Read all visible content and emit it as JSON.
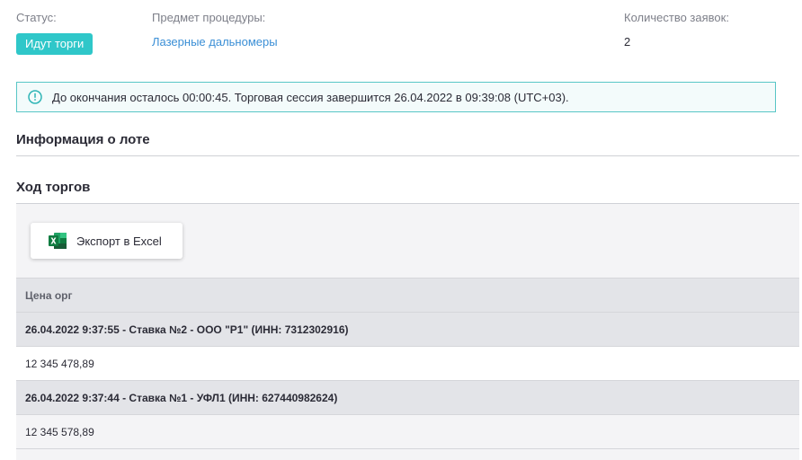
{
  "status": {
    "label": "Статус:",
    "badge": "Идут торги"
  },
  "subject": {
    "label": "Предмет процедуры:",
    "value": "Лазерные дальномеры"
  },
  "applications": {
    "label": "Количество заявок:",
    "value": "2"
  },
  "alert": {
    "text": "До окончания осталось 00:00:45. Торговая сессия завершится 26.04.2022 в 09:39:08 (UTC+03).",
    "icon": "info-icon"
  },
  "sections": {
    "lot_info": "Информация о лоте",
    "bidding": "Ход торгов"
  },
  "export": {
    "label": "Экспорт в Excel",
    "icon": "excel-icon"
  },
  "table": {
    "header": "Цена орг",
    "rows": [
      {
        "bid": "26.04.2022 9:37:55 - Ставка №2  - ООО \"Р1\" (ИНН: 7312302916)",
        "price": "12 345 478,89"
      },
      {
        "bid": "26.04.2022 9:37:44 - Ставка №1 - УФЛ1 (ИНН: 627440982624)",
        "price": "12 345 578,89"
      }
    ]
  },
  "colors": {
    "accent": "#2fc7c9",
    "link": "#3b8fd6",
    "alert_border": "#58c6c6"
  }
}
